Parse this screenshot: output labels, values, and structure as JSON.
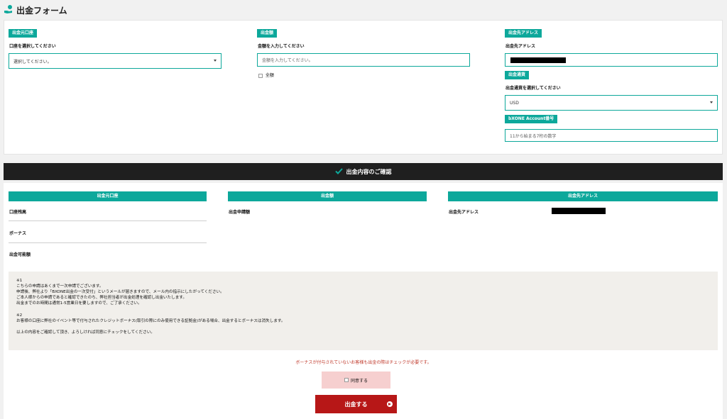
{
  "header": {
    "title": "出金フォーム",
    "logo_icon": "money-hand-icon"
  },
  "form": {
    "account": {
      "tag": "出金元口座",
      "label": "口座を選択してください",
      "select_value": "選択してください。"
    },
    "amount": {
      "tag": "出金額",
      "label": "金額を入力してください",
      "placeholder": "金額を入力してください。",
      "all_label": "全額"
    },
    "address": {
      "tag": "出金先アドレス",
      "label": "出金先アドレス",
      "currency_tag": "出金通貨",
      "currency_label": "出金通貨を選択してください",
      "currency_value": "USD",
      "bxone_tag": "bXONE Account番号",
      "bxone_placeholder": "11から始まる7桁の数字"
    }
  },
  "confirm": {
    "bar_title": "出金内容のご確認",
    "bar_icon": "check-icon",
    "col_account": {
      "header": "出金元口座",
      "rows": [
        "口座残高",
        "ボーナス",
        "出金可能額"
      ]
    },
    "col_amount": {
      "header": "出金額",
      "rows": [
        "出金申請額"
      ]
    },
    "col_address": {
      "header": "出金先アドレス",
      "rows": [
        "出金先アドレス"
      ]
    }
  },
  "notes": {
    "lines": [
      "※1",
      "こちらの申請はあくまで一次申請でございます。",
      "申請後、弊社より「BXONE出金の一次受付」というメールが届きますので、メール内の指示にしたがってください。",
      "ご本人様からの申請であると確認できたのち、弊社担当者が出金処理を確認し出金いたします。",
      "出金までのお時間は通常1-5営業日を要しますので、ご了承ください。",
      "",
      "※2",
      "お客様の口座に弊社のイベント等で付与されたクレジットボーナス(取引の際にのみ使用できる証拠金)がある場合、出金するとボーナスは消失します。",
      "",
      "以上の内容をご確認して頂き、よろしければ同意にチェックをしてください。"
    ]
  },
  "warning": "ボーナスが付与されていないお客様も出金の際はチェックが必要です。",
  "agree_label": "同意する",
  "submit_label": "出金する",
  "colors": {
    "accent": "#0da89b",
    "submit": "#b71717",
    "warning": "#c0392b",
    "bar": "#1f1f1f"
  }
}
